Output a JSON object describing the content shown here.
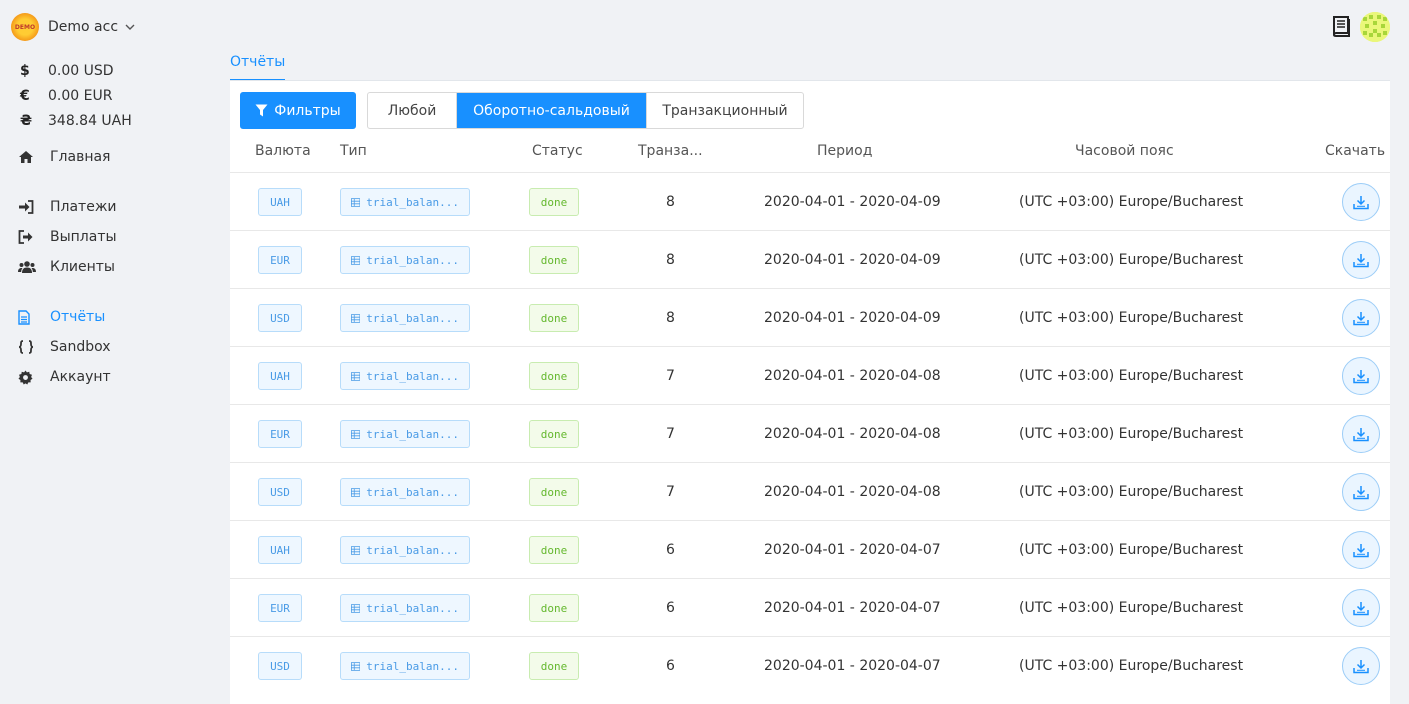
{
  "account": {
    "logo_text": "DEMO",
    "name": "Demo acc"
  },
  "balances": [
    {
      "symbol": "$",
      "amount": "0.00 USD"
    },
    {
      "symbol": "€",
      "amount": "0.00 EUR"
    },
    {
      "symbol": "₴",
      "amount": "348.84 UAH"
    }
  ],
  "nav": {
    "home": "Главная",
    "payments": "Платежи",
    "payouts": "Выплаты",
    "clients": "Клиенты",
    "reports": "Отчёты",
    "sandbox": "Sandbox",
    "account": "Аккаунт"
  },
  "page": {
    "tab": "Отчёты"
  },
  "toolbar": {
    "filters": "Фильтры",
    "segments": [
      "Любой",
      "Оборотно-сальдовый",
      "Транзакционный"
    ],
    "selected_segment": "Оборотно-сальдовый"
  },
  "table": {
    "headers": [
      "Валюта",
      "Тип",
      "Статус",
      "Транза...",
      "Период",
      "Часовой пояс",
      "Скачать"
    ],
    "rows": [
      {
        "currency": "UAH",
        "type": "trial_balan...",
        "status": "done",
        "transactions": "8",
        "period": "2020-04-01 - 2020-04-09",
        "timezone": "(UTC +03:00) Europe/Bucharest"
      },
      {
        "currency": "EUR",
        "type": "trial_balan...",
        "status": "done",
        "transactions": "8",
        "period": "2020-04-01 - 2020-04-09",
        "timezone": "(UTC +03:00) Europe/Bucharest"
      },
      {
        "currency": "USD",
        "type": "trial_balan...",
        "status": "done",
        "transactions": "8",
        "period": "2020-04-01 - 2020-04-09",
        "timezone": "(UTC +03:00) Europe/Bucharest"
      },
      {
        "currency": "UAH",
        "type": "trial_balan...",
        "status": "done",
        "transactions": "7",
        "period": "2020-04-01 - 2020-04-08",
        "timezone": "(UTC +03:00) Europe/Bucharest"
      },
      {
        "currency": "EUR",
        "type": "trial_balan...",
        "status": "done",
        "transactions": "7",
        "period": "2020-04-01 - 2020-04-08",
        "timezone": "(UTC +03:00) Europe/Bucharest"
      },
      {
        "currency": "USD",
        "type": "trial_balan...",
        "status": "done",
        "transactions": "7",
        "period": "2020-04-01 - 2020-04-08",
        "timezone": "(UTC +03:00) Europe/Bucharest"
      },
      {
        "currency": "UAH",
        "type": "trial_balan...",
        "status": "done",
        "transactions": "6",
        "period": "2020-04-01 - 2020-04-07",
        "timezone": "(UTC +03:00) Europe/Bucharest"
      },
      {
        "currency": "EUR",
        "type": "trial_balan...",
        "status": "done",
        "transactions": "6",
        "period": "2020-04-01 - 2020-04-07",
        "timezone": "(UTC +03:00) Europe/Bucharest"
      },
      {
        "currency": "USD",
        "type": "trial_balan...",
        "status": "done",
        "transactions": "6",
        "period": "2020-04-01 - 2020-04-07",
        "timezone": "(UTC +03:00) Europe/Bucharest"
      }
    ]
  },
  "colors": {
    "accent": "#1890ff",
    "done": "#65b82e"
  }
}
